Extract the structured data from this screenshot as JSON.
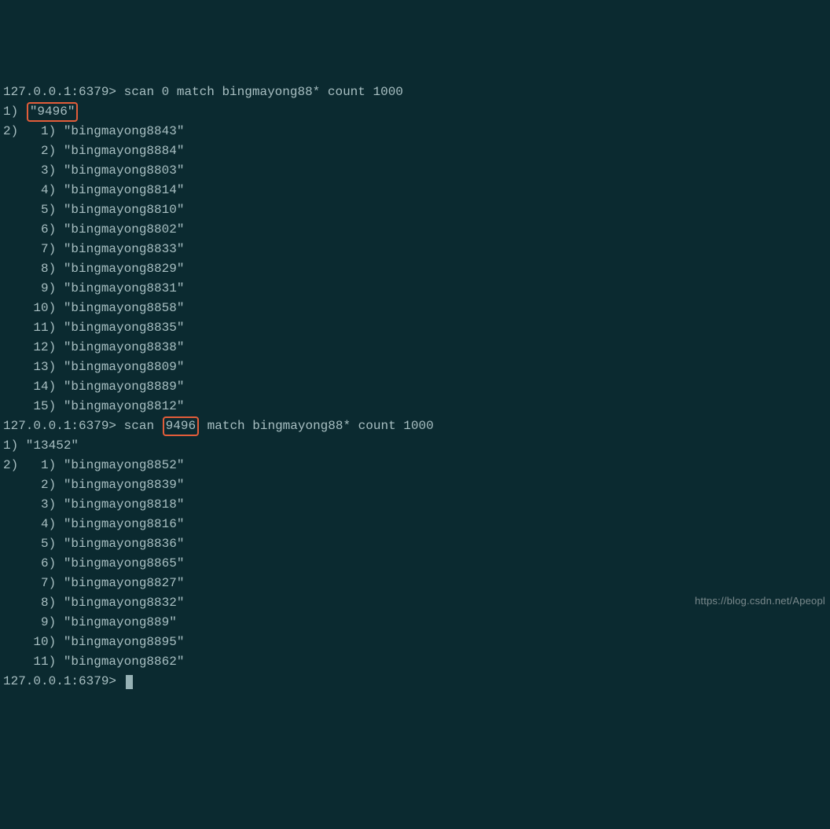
{
  "prompt": "127.0.0.1:6379>",
  "cmd1_pre": " scan 0 match bingmayong88* count 1000",
  "cursor1_label": "1)",
  "cursor1_val": "\"9496\"",
  "list_label": "2)",
  "results1": [
    "\"bingmayong8843\"",
    "\"bingmayong8884\"",
    "\"bingmayong8803\"",
    "\"bingmayong8814\"",
    "\"bingmayong8810\"",
    "\"bingmayong8802\"",
    "\"bingmayong8833\"",
    "\"bingmayong8829\"",
    "\"bingmayong8831\"",
    "\"bingmayong8858\"",
    "\"bingmayong8835\"",
    "\"bingmayong8838\"",
    "\"bingmayong8809\"",
    "\"bingmayong8889\"",
    "\"bingmayong8812\""
  ],
  "cmd2_pre": " scan ",
  "cmd2_cursor": "9496",
  "cmd2_post": " match bingmayong88* count 1000",
  "cursor2_label": "1)",
  "cursor2_val": " \"13452\"",
  "results2": [
    "\"bingmayong8852\"",
    "\"bingmayong8839\"",
    "\"bingmayong8818\"",
    "\"bingmayong8816\"",
    "\"bingmayong8836\"",
    "\"bingmayong8865\"",
    "\"bingmayong8827\"",
    "\"bingmayong8832\"",
    "\"bingmayong889\"",
    "\"bingmayong8895\"",
    "\"bingmayong8862\""
  ],
  "watermark": "https://blog.csdn.net/Apeopl"
}
